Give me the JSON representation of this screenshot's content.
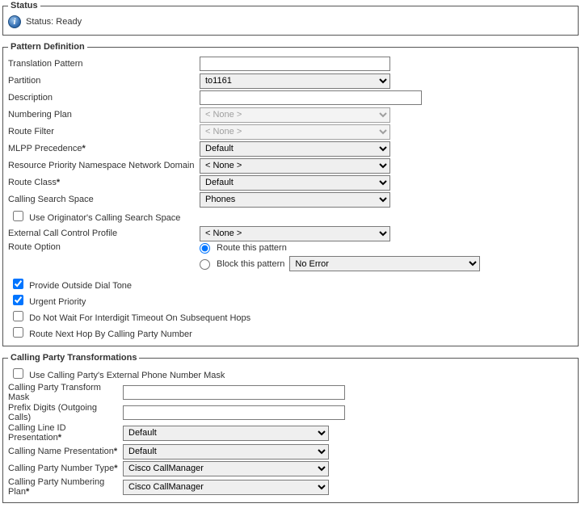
{
  "status": {
    "legend": "Status",
    "text": "Status: Ready"
  },
  "patternDef": {
    "legend": "Pattern Definition",
    "translationPattern": {
      "label": "Translation Pattern",
      "value": ""
    },
    "partition": {
      "label": "Partition",
      "value": "to1161"
    },
    "description": {
      "label": "Description",
      "value": ""
    },
    "numberingPlan": {
      "label": "Numbering Plan",
      "value": "< None >"
    },
    "routeFilter": {
      "label": "Route Filter",
      "value": "< None >"
    },
    "mlppPrecedence": {
      "label": "MLPP Precedence",
      "value": "Default"
    },
    "resourcePriority": {
      "label": "Resource Priority Namespace Network Domain",
      "value": "< None >"
    },
    "routeClass": {
      "label": "Route Class",
      "value": "Default"
    },
    "callingSearchSpace": {
      "label": "Calling Search Space",
      "value": "Phones"
    },
    "useOriginatorsCSS": {
      "label": "Use Originator's Calling Search Space",
      "checked": false
    },
    "externalCallControl": {
      "label": "External Call Control Profile",
      "value": "< None >"
    },
    "routeOption": {
      "label": "Route Option",
      "routeLabel": "Route this pattern",
      "blockLabel": "Block this pattern",
      "blockReason": "No Error",
      "selected": "route"
    },
    "provideDialTone": {
      "label": "Provide Outside Dial Tone",
      "checked": true
    },
    "urgentPriority": {
      "label": "Urgent Priority",
      "checked": true
    },
    "doNotWait": {
      "label": "Do Not Wait For Interdigit Timeout On Subsequent Hops",
      "checked": false
    },
    "routeNextHop": {
      "label": "Route Next Hop By Calling Party Number",
      "checked": false
    }
  },
  "callingParty": {
    "legend": "Calling Party Transformations",
    "useExternalMask": {
      "label": "Use Calling Party's External Phone Number Mask",
      "checked": false
    },
    "transformMask": {
      "label": "Calling Party Transform Mask",
      "value": ""
    },
    "prefixDigits": {
      "label": "Prefix Digits (Outgoing Calls)",
      "value": ""
    },
    "lineIdPresentation": {
      "label": "Calling Line ID Presentation",
      "value": "Default"
    },
    "namePresentation": {
      "label": "Calling Name Presentation",
      "value": "Default"
    },
    "numberType": {
      "label": "Calling Party Number Type",
      "value": "Cisco CallManager"
    },
    "numberingPlan": {
      "label": "Calling Party Numbering Plan",
      "value": "Cisco CallManager"
    }
  }
}
